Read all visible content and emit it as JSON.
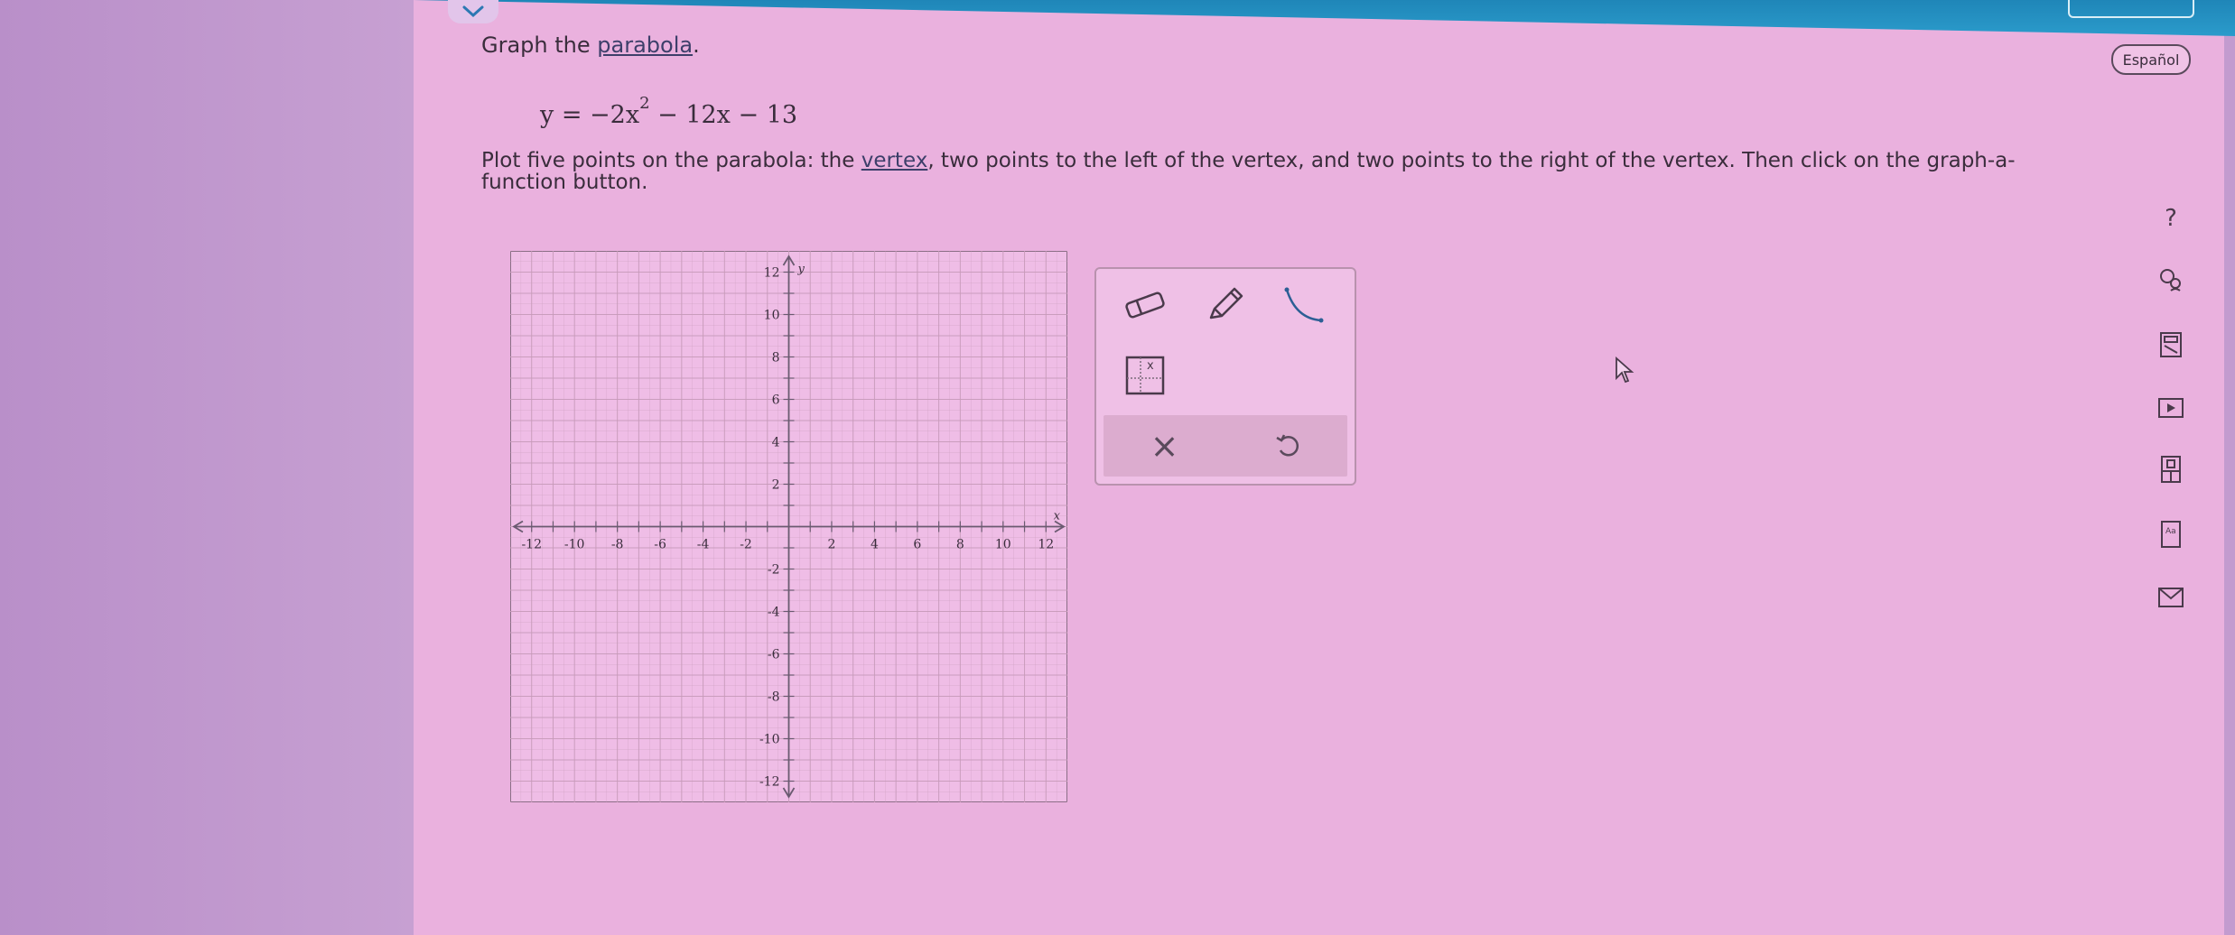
{
  "header": {
    "collapse_icon": "chevron-down-icon",
    "language_button": "Español"
  },
  "problem": {
    "prompt_prefix": "Graph the ",
    "prompt_link": "parabola",
    "prompt_suffix": ".",
    "equation_lhs": "y = −2x",
    "equation_exponent": "2",
    "equation_rhs": " − 12x − 13",
    "instruction_prefix": "Plot five points on the parabola: the ",
    "instruction_link": "vertex",
    "instruction_suffix": ", two points to the left of the vertex, and two points to the right of the vertex. Then click on the graph-a-function button."
  },
  "graph": {
    "x_axis_label": "x",
    "y_axis_label": "y",
    "x_range": [
      -13,
      13
    ],
    "y_range": [
      -13,
      13
    ],
    "x_tick_labels": [
      "-12",
      "-10",
      "-8",
      "-6",
      "-4",
      "-2",
      "2",
      "4",
      "6",
      "8",
      "10",
      "12"
    ],
    "y_tick_labels": [
      "12",
      "10",
      "8",
      "6",
      "4",
      "2",
      "-2",
      "-4",
      "-6",
      "-8",
      "-10",
      "-12"
    ],
    "grid": true
  },
  "tools": {
    "eraser_icon": "eraser-icon",
    "pencil_icon": "pencil-icon",
    "curve_icon": "parabola-curve-icon",
    "graph_function_icon": "graph-a-function-icon",
    "clear_label": "×",
    "undo_icon": "undo-icon"
  },
  "sidebar_icons": [
    "help-icon",
    "ask-question-icon",
    "calculator-icon",
    "video-icon",
    "textbook-icon",
    "glossary-icon",
    "message-icon"
  ],
  "sidebar_help_label": "?",
  "colors": {
    "panel": "#eab1de",
    "topbar": "#1f86b8",
    "grid_line": "#c79ab9",
    "axis": "#6a5a70"
  }
}
